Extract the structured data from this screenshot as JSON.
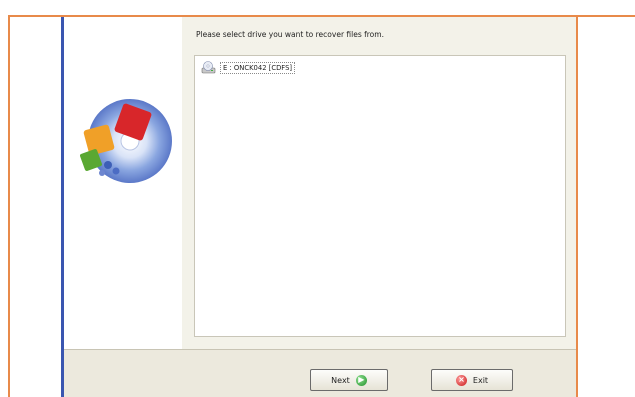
{
  "instruction": "Please select drive you want to recover files from.",
  "drives": [
    {
      "label": "E : ONCK042 [CDFS]",
      "icon": "cd-drive-icon"
    }
  ],
  "buttons": {
    "next_label": "Next",
    "exit_label": "Exit"
  },
  "colors": {
    "frame": "#e88a4a",
    "window_border": "#3a56b0",
    "next_icon": "#1f8f2a",
    "exit_icon": "#c81818"
  }
}
